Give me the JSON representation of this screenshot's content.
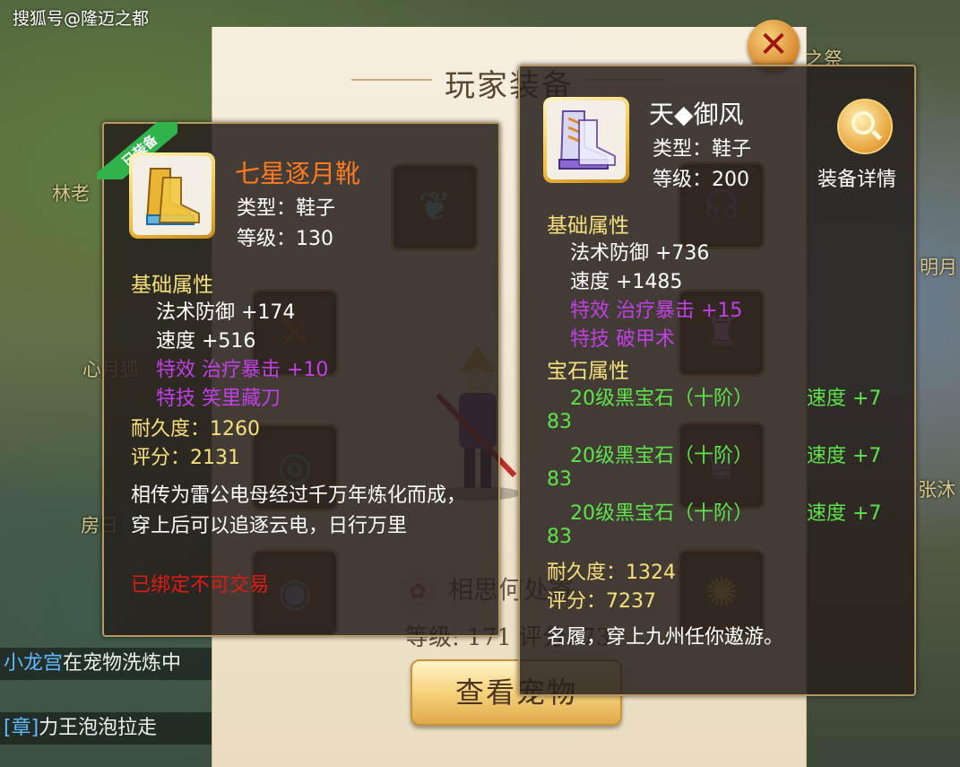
{
  "watermark": "搜狐号@隆迈之都",
  "background_text": {
    "npc_1": "林老",
    "npc_2": "心月狐",
    "npc_3": "房日",
    "npc_4": "明月",
    "npc_5": "张沐",
    "npc_6": "之祭"
  },
  "chat": [
    {
      "tag": "小龙宫",
      "text": "在宠物洗炼中"
    },
    {
      "tag": "[章]",
      "text": "力王泡泡拉走"
    }
  ],
  "panel": {
    "title": "玩家装备",
    "pet_name": "相思何处寄",
    "pet_stats": "等级: 171 评分: 73"
  },
  "view_pet_label": "查看宠物",
  "left_item": {
    "equipped_badge": "已装备",
    "name": "七星逐月靴",
    "type": "类型：鞋子",
    "level": "等级：130",
    "base_header": "基础属性",
    "stats": [
      "法术防御  +174",
      "速度  +516"
    ],
    "effect": "特效  治疗暴击  +10",
    "skill": "特技  笑里藏刀",
    "durability": "耐久度：1260",
    "score": "评分：2131",
    "description": "相传为雷公电母经过千万年炼化而成，穿上后可以追逐云电，日行万里",
    "bound": "已绑定不可交易",
    "name_color": "#ff7a1f"
  },
  "right_item": {
    "name": "天◆御风",
    "type": "类型：鞋子",
    "level": "等级：200",
    "base_header": "基础属性",
    "stats": [
      "法术防御  +736",
      "速度  +1485"
    ],
    "effect": "特效  治疗暴击  +15",
    "skill": "特技  破甲术",
    "gem_header": "宝石属性",
    "gems": [
      {
        "name": "20级黑宝石（十阶）",
        "stat": "速度  +7",
        "overflow": "83"
      },
      {
        "name": "20级黑宝石（十阶）",
        "stat": "速度  +7",
        "overflow": "83"
      },
      {
        "name": "20级黑宝石（十阶）",
        "stat": "速度  +7",
        "overflow": "83"
      }
    ],
    "durability": "耐久度：1324",
    "score": "评分：7237",
    "description": "名履，穿上九州任你遨游。",
    "detail_label": "装备详情"
  },
  "icons": {
    "close": "close-icon",
    "detail": "magnifier-icon",
    "boots": "boots-icon",
    "lotus": "lotus-icon"
  }
}
